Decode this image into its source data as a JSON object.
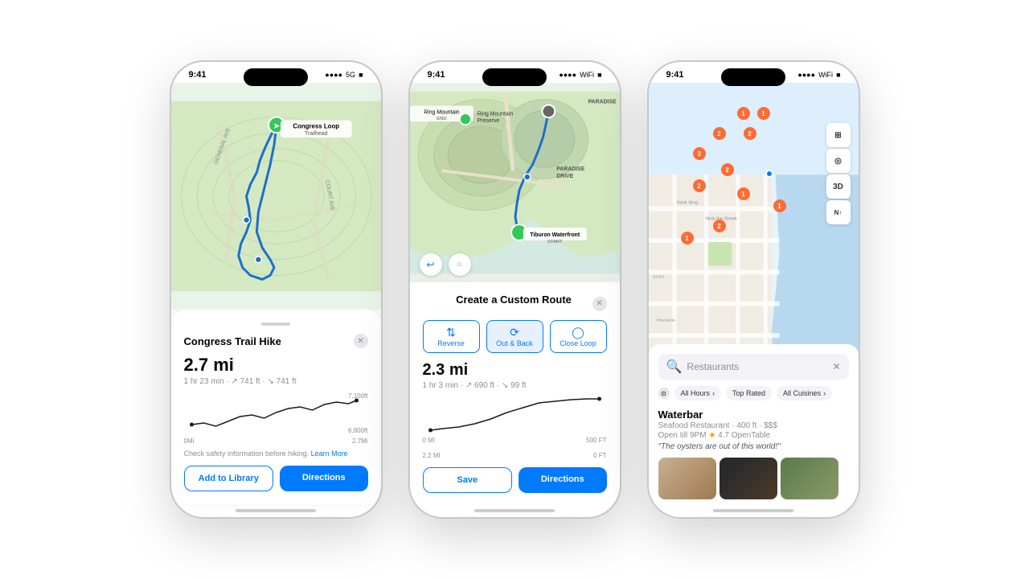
{
  "phones": [
    {
      "id": "phone1",
      "statusBar": {
        "time": "9:41",
        "signal": "●●●● 5G",
        "battery": "▊"
      },
      "sheet": {
        "title": "Congress Trail Hike",
        "distance": "2.7 mi",
        "details": "1 hr 23 min · ↗ 741 ft · ↘ 741 ft",
        "elevHigh": "7,100ft",
        "elevLow": "6,800ft",
        "distStart": "0Mi",
        "distEnd": "2.7Mi",
        "safetyText": "Check safety information before hiking.",
        "learnMore": "Learn More",
        "btn1": "Add to Library",
        "btn2": "Directions"
      }
    },
    {
      "id": "phone2",
      "statusBar": {
        "time": "9:41",
        "signal": "●●●● WiFi",
        "battery": "▊"
      },
      "sheet": {
        "title": "Create a Custom Route",
        "options": [
          "Reverse",
          "Out & Back",
          "Close Loop"
        ],
        "distance": "2.3 mi",
        "details": "1 hr 3 min · ↗ 690 ft · ↘ 99 ft",
        "elevHigh": "500 FT",
        "elevLow": "0 FT",
        "distStart": "0 MI",
        "distEnd": "2.2 MI",
        "btn1": "Save",
        "btn2": "Directions"
      }
    },
    {
      "id": "phone3",
      "statusBar": {
        "time": "9:41",
        "signal": "●●●● WiFi",
        "battery": "▊"
      },
      "search": {
        "placeholder": "Restaurants",
        "clearBtn": "✕"
      },
      "filters": {
        "icon": "⊙",
        "hours": "All Hours",
        "rating": "Top Rated",
        "cuisine": "All Cuisines"
      },
      "restaurant": {
        "name": "Waterbar",
        "type": "Seafood Restaurant · 400 ft · $$$",
        "hours": "Open till 9PM",
        "rating": "★ 4.7 OpenTable",
        "quote": "\"The oysters are out of this world!\""
      }
    }
  ]
}
